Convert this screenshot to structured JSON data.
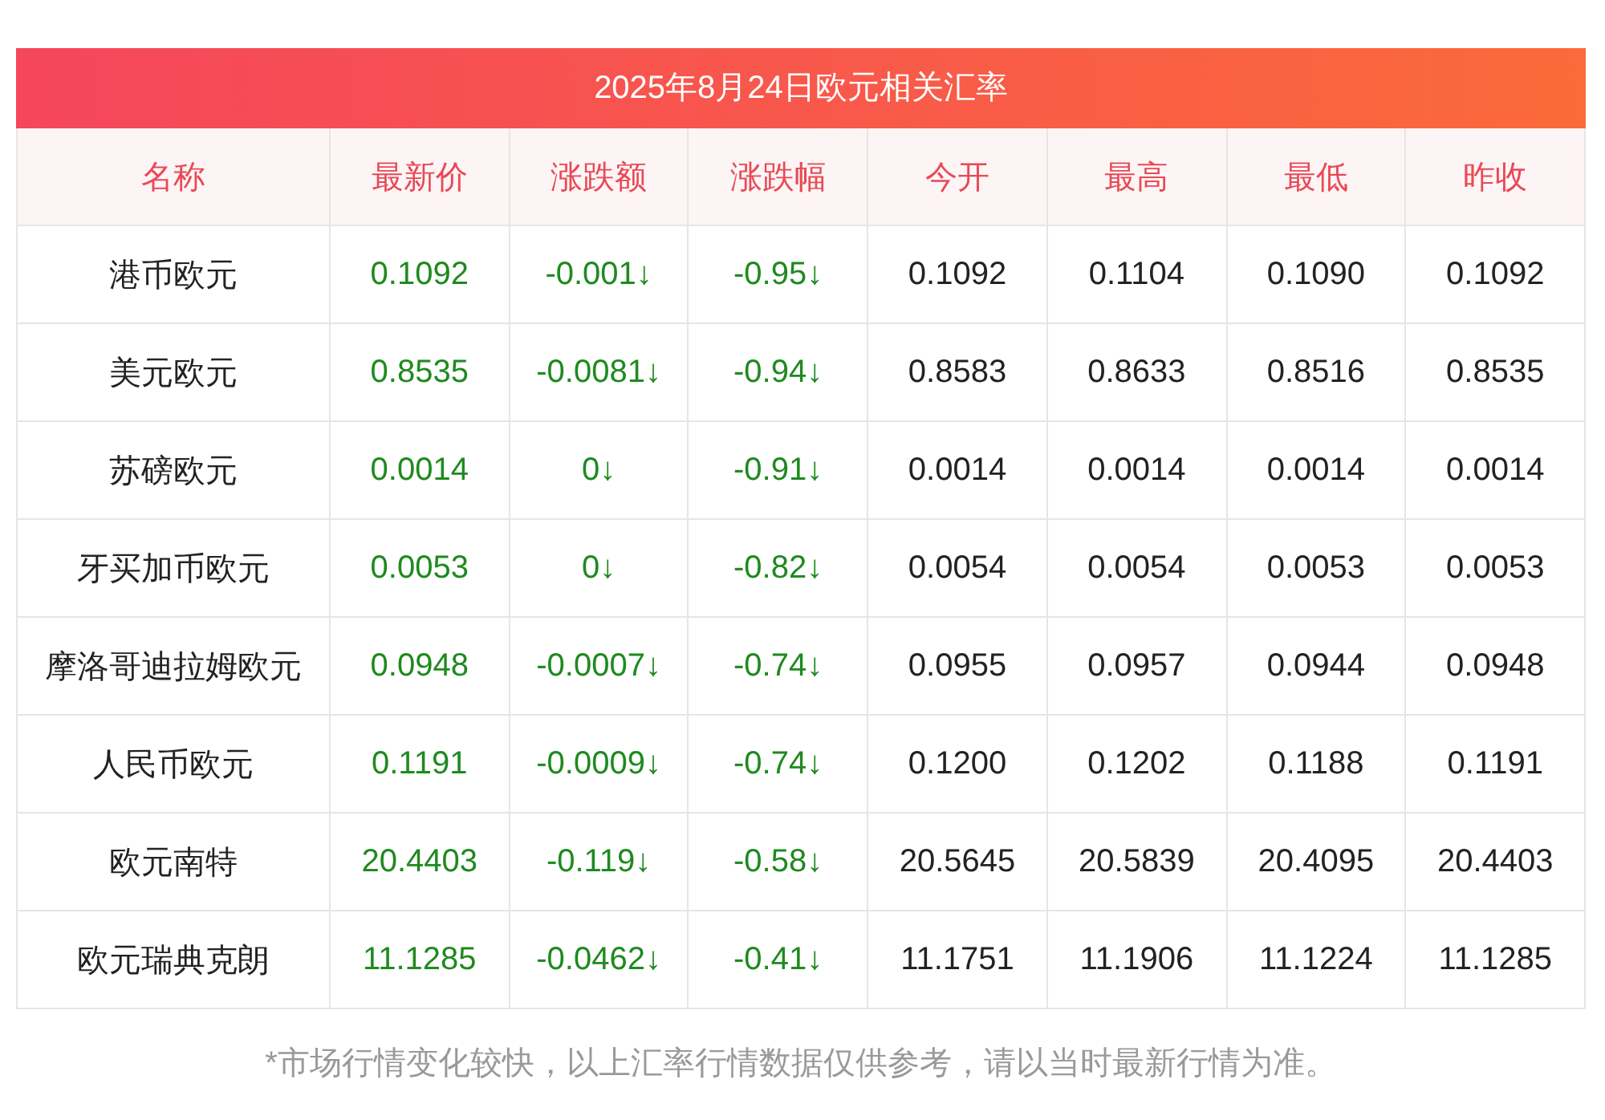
{
  "title": "2025年8月24日欧元相关汇率",
  "columns": [
    "名称",
    "最新价",
    "涨跌额",
    "涨跌幅",
    "今开",
    "最高",
    "最低",
    "昨收"
  ],
  "rows": [
    {
      "name": "港币欧元",
      "color": "#1f8a1f",
      "latest": "0.1092",
      "change": "-0.001↓",
      "change_pct": "-0.95↓",
      "open": "0.1092",
      "high": "0.1104",
      "low": "0.1090",
      "prev_close": "0.1092"
    },
    {
      "name": "美元欧元",
      "color": "#1f8a1f",
      "latest": "0.8535",
      "change": "-0.0081↓",
      "change_pct": "-0.94↓",
      "open": "0.8583",
      "high": "0.8633",
      "low": "0.8516",
      "prev_close": "0.8535"
    },
    {
      "name": "苏磅欧元",
      "color": "#1f8a1f",
      "latest": "0.0014",
      "change": "0↓",
      "change_pct": "-0.91↓",
      "open": "0.0014",
      "high": "0.0014",
      "low": "0.0014",
      "prev_close": "0.0014"
    },
    {
      "name": "牙买加币欧元",
      "color": "#1f8a1f",
      "latest": "0.0053",
      "change": "0↓",
      "change_pct": "-0.82↓",
      "open": "0.0054",
      "high": "0.0054",
      "low": "0.0053",
      "prev_close": "0.0053"
    },
    {
      "name": "摩洛哥迪拉姆欧元",
      "color": "#1f8a1f",
      "latest": "0.0948",
      "change": "-0.0007↓",
      "change_pct": "-0.74↓",
      "open": "0.0955",
      "high": "0.0957",
      "low": "0.0944",
      "prev_close": "0.0948"
    },
    {
      "name": "人民币欧元",
      "color": "#1f8a1f",
      "latest": "0.1191",
      "change": "-0.0009↓",
      "change_pct": "-0.74↓",
      "open": "0.1200",
      "high": "0.1202",
      "low": "0.1188",
      "prev_close": "0.1191"
    },
    {
      "name": "欧元南特",
      "color": "#1f8a1f",
      "latest": "20.4403",
      "change": "-0.119↓",
      "change_pct": "-0.58↓",
      "open": "20.5645",
      "high": "20.5839",
      "low": "20.4095",
      "prev_close": "20.4403"
    },
    {
      "name": "欧元瑞典克朗",
      "color": "#1f8a1f",
      "latest": "11.1285",
      "change": "-0.0462↓",
      "change_pct": "-0.41↓",
      "open": "11.1751",
      "high": "11.1906",
      "low": "11.1224",
      "prev_close": "11.1285"
    }
  ],
  "note": "*市场行情变化较快，以上汇率行情数据仅供参考，请以当时最新行情为准。"
}
